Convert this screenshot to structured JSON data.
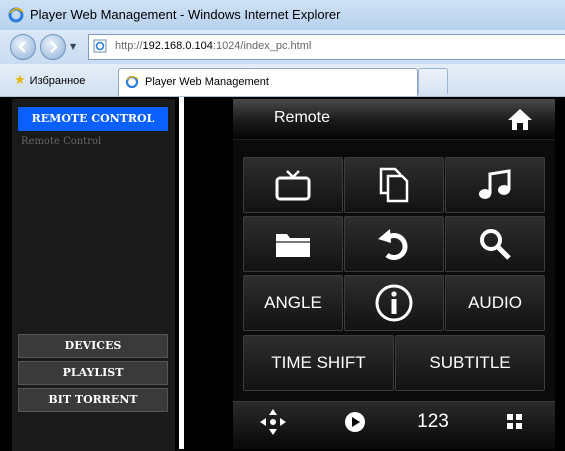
{
  "window": {
    "title": "Player Web Management - Windows Internet Explorer"
  },
  "browser": {
    "url_prefix": "http://",
    "url_host": "192.168.0.104",
    "url_rest": ":1024/index_pc.html",
    "favorites_label": "Избранное",
    "tab_label": "Player Web Management"
  },
  "sidebar": {
    "active_label": "REMOTE CONTROL",
    "sub_label": "Remote Control",
    "items": [
      "DEVICES",
      "PLAYLIST",
      "BIT TORRENT"
    ]
  },
  "remote": {
    "title": "Remote",
    "buttons": {
      "angle": "ANGLE",
      "audio": "AUDIO",
      "time_shift": "TIME SHIFT",
      "subtitle": "SUBTITLE"
    },
    "bottom": {
      "numpad": "123"
    }
  },
  "colors": {
    "accent": "#0a60ff",
    "panel": "#0b0b0b"
  }
}
